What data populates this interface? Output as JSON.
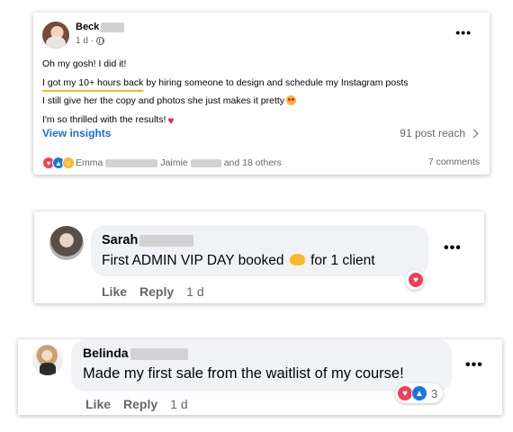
{
  "post": {
    "author": "Beck",
    "time": "1 d ·",
    "lines": [
      "Oh my gosh! I did it!",
      "I got my 10+ hours back",
      " by hiring someone to design and schedule my Instagram posts",
      "I still give her the copy and photos she just makes it pretty",
      "I'm so thrilled with the results!"
    ],
    "view_insights": "View insights",
    "post_reach": "91 post reach",
    "reactors": [
      "Emma",
      "Jaimie",
      "and 18 others"
    ],
    "comments": "7 comments",
    "more": "•••"
  },
  "comments": [
    {
      "name": "Sarah",
      "text_before": "First ADMIN VIP DAY booked",
      "text_after": "for 1 client",
      "like": "Like",
      "reply": "Reply",
      "time": "1 d",
      "more": "•••",
      "reaction_count": ""
    },
    {
      "name": "Belinda",
      "text": "Made my first sale from the waitlist of my course!",
      "like": "Like",
      "reply": "Reply",
      "time": "1 d",
      "more": "•••",
      "reaction_count": "3"
    }
  ],
  "icons": {
    "love": "♥",
    "like": "👍",
    "care": "☺"
  },
  "colors": {
    "link_blue": "#1f6cd9",
    "love": "#f33e58",
    "like": "#1b74e4",
    "highlight_underline": "#f7b928"
  }
}
